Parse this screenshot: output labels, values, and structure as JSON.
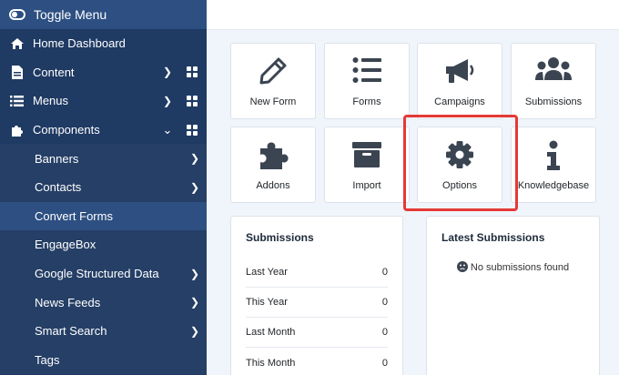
{
  "sidebar": {
    "toggle_label": "Toggle Menu",
    "items": [
      {
        "label": "Home Dashboard",
        "icon": "home-icon"
      },
      {
        "label": "Content",
        "icon": "file-icon"
      },
      {
        "label": "Menus",
        "icon": "list-icon"
      },
      {
        "label": "Components",
        "icon": "puzzle-icon"
      }
    ],
    "subitems": [
      {
        "label": "Banners"
      },
      {
        "label": "Contacts"
      },
      {
        "label": "Convert Forms"
      },
      {
        "label": "EngageBox"
      },
      {
        "label": "Google Structured Data"
      },
      {
        "label": "News Feeds"
      },
      {
        "label": "Smart Search"
      },
      {
        "label": "Tags"
      }
    ]
  },
  "tiles": [
    {
      "label": "New Form",
      "icon": "pencil-icon"
    },
    {
      "label": "Forms",
      "icon": "list-icon"
    },
    {
      "label": "Campaigns",
      "icon": "megaphone-icon"
    },
    {
      "label": "Submissions",
      "icon": "users-icon"
    },
    {
      "label": "Addons",
      "icon": "puzzle-icon"
    },
    {
      "label": "Import",
      "icon": "archive-icon"
    },
    {
      "label": "Options",
      "icon": "gear-icon"
    },
    {
      "label": "Knowledgebase",
      "icon": "info-icon"
    }
  ],
  "submissions": {
    "title": "Submissions",
    "rows": [
      {
        "label": "Last Year",
        "value": "0"
      },
      {
        "label": "This Year",
        "value": "0"
      },
      {
        "label": "Last Month",
        "value": "0"
      },
      {
        "label": "This Month",
        "value": "0"
      }
    ]
  },
  "latest": {
    "title": "Latest Submissions",
    "empty": "No submissions found",
    "empty_icon": "frown-icon"
  },
  "colors": {
    "sidebar": "#1f3a63",
    "sidebar_active": "#2d4f82",
    "highlight": "#e53935",
    "icon": "#3b4451"
  }
}
